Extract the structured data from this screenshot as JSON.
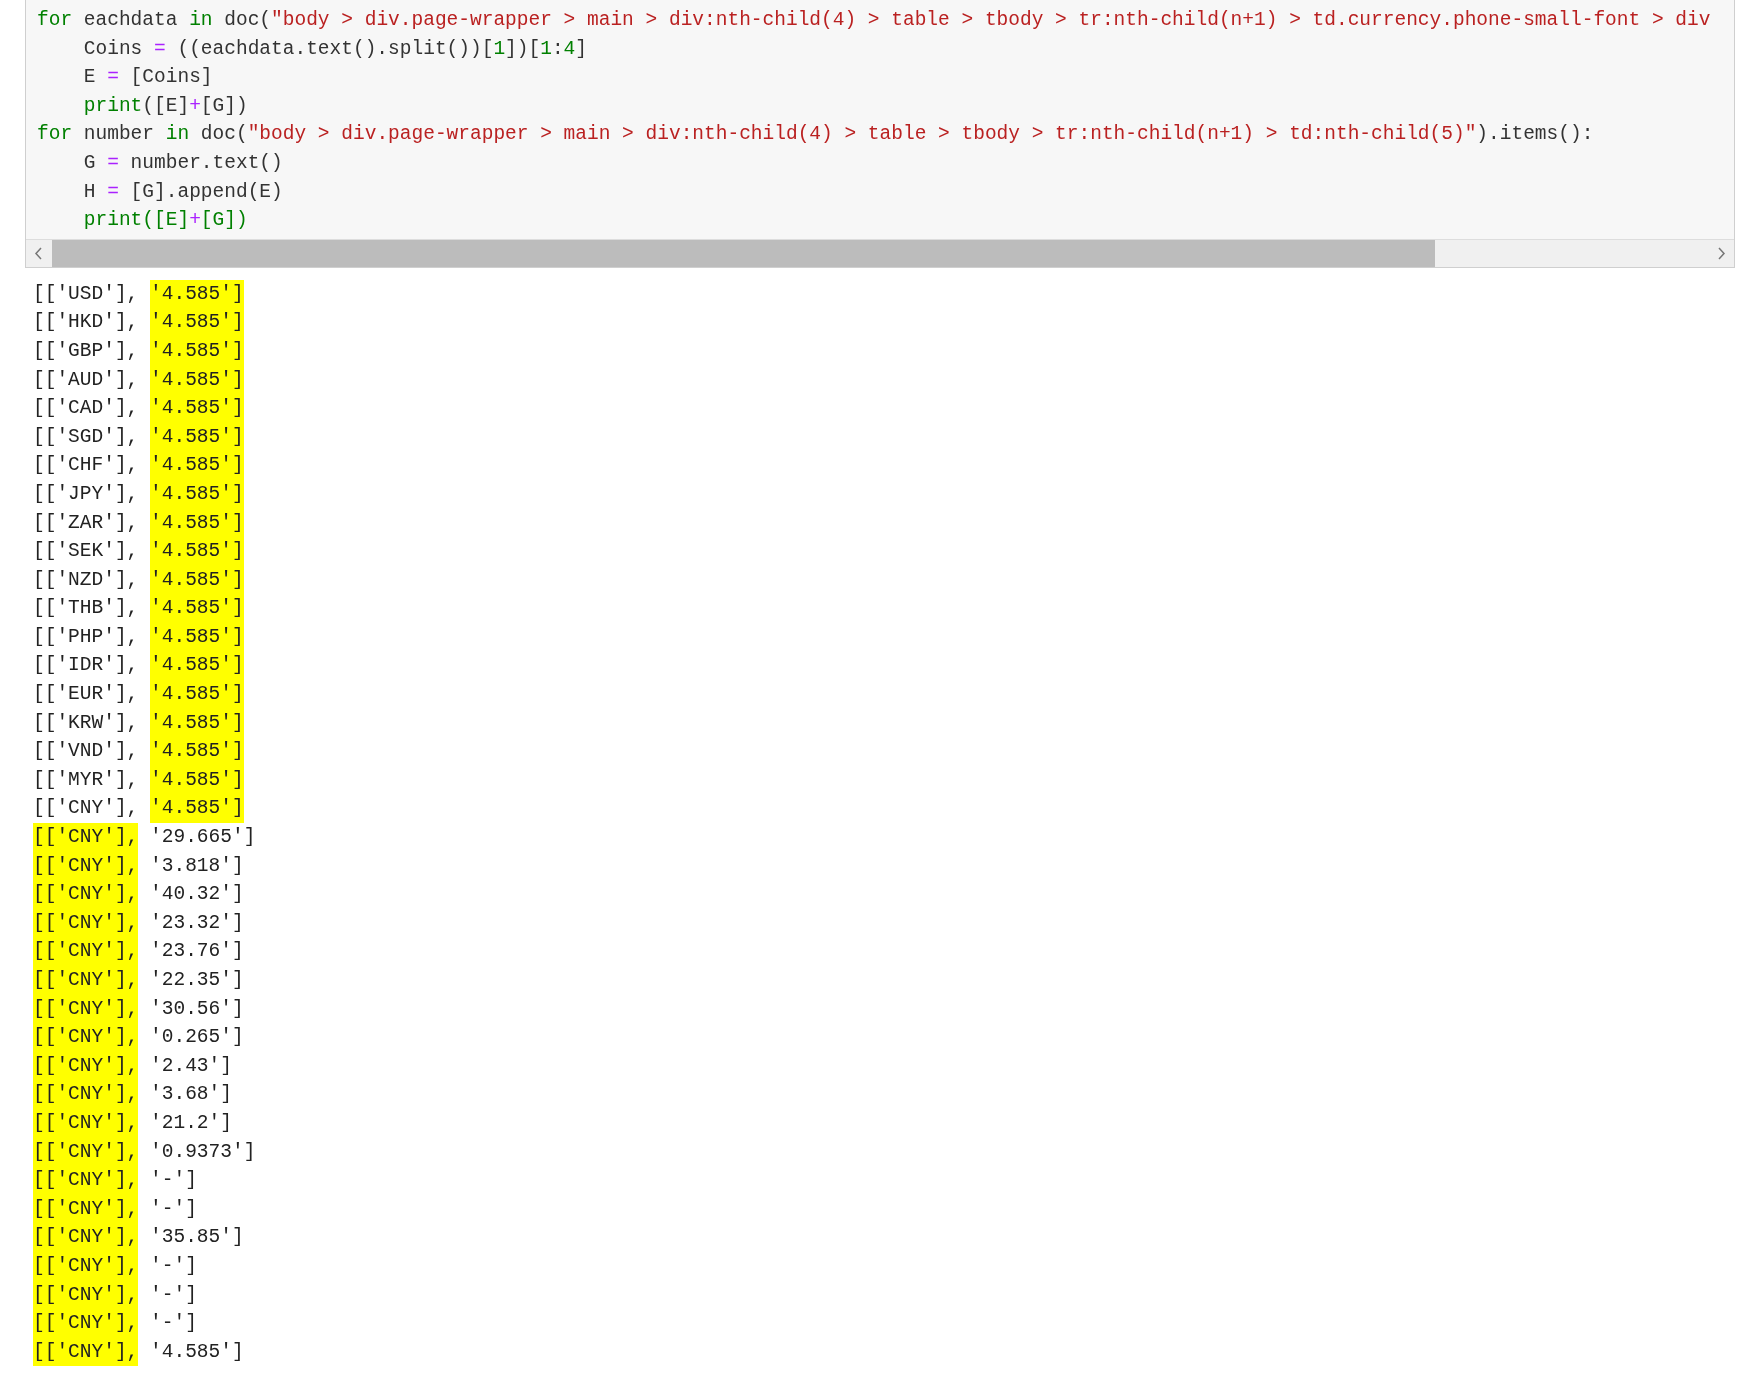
{
  "code_cell": {
    "lines": [
      [
        {
          "kind": "keyword",
          "text": "for"
        },
        {
          "kind": "plain",
          "text": " eachdata "
        },
        {
          "kind": "keyword",
          "text": "in"
        },
        {
          "kind": "plain",
          "text": " doc("
        },
        {
          "kind": "string",
          "text": "\"body > div.page-wrapper > main > div:nth-child(4) > table > tbody > tr:nth-child(n+1) > td.currency.phone-small-font > div"
        }
      ],
      [
        {
          "kind": "plain",
          "text": "    Coins "
        },
        {
          "kind": "operator",
          "text": "="
        },
        {
          "kind": "plain",
          "text": " ((eachdata.text().split())["
        },
        {
          "kind": "number",
          "text": "1"
        },
        {
          "kind": "plain",
          "text": "])["
        },
        {
          "kind": "number",
          "text": "1"
        },
        {
          "kind": "plain",
          "text": ":"
        },
        {
          "kind": "number",
          "text": "4"
        },
        {
          "kind": "plain",
          "text": "]"
        }
      ],
      [
        {
          "kind": "plain",
          "text": "    E "
        },
        {
          "kind": "operator",
          "text": "="
        },
        {
          "kind": "plain",
          "text": " [Coins]"
        }
      ],
      [
        {
          "kind": "builtin",
          "text": "    print"
        },
        {
          "kind": "plain",
          "text": "([E]"
        },
        {
          "kind": "operator",
          "text": "+"
        },
        {
          "kind": "plain",
          "text": "[G])"
        }
      ],
      [
        {
          "kind": "keyword",
          "text": "for"
        },
        {
          "kind": "plain",
          "text": " number "
        },
        {
          "kind": "keyword",
          "text": "in"
        },
        {
          "kind": "plain",
          "text": " doc("
        },
        {
          "kind": "string",
          "text": "\"body > div.page-wrapper > main > div:nth-child(4) > table > tbody > tr:nth-child(n+1) > td:nth-child(5)\""
        },
        {
          "kind": "plain",
          "text": ").items():"
        }
      ],
      [
        {
          "kind": "plain",
          "text": "    G "
        },
        {
          "kind": "operator",
          "text": "="
        },
        {
          "kind": "plain",
          "text": " number.text()"
        }
      ],
      [
        {
          "kind": "plain",
          "text": "    H "
        },
        {
          "kind": "operator",
          "text": "="
        },
        {
          "kind": "plain",
          "text": " [G].append(E)"
        }
      ],
      [
        {
          "kind": "builtin",
          "text": "    print([E]"
        },
        {
          "kind": "operator",
          "text": "+"
        },
        {
          "kind": "builtin",
          "text": "[G])"
        }
      ]
    ]
  },
  "output": [
    {
      "currency": "[['USD'],",
      "value": "'4.585']",
      "currency_highlighted": false,
      "value_highlighted": true
    },
    {
      "currency": "[['HKD'],",
      "value": "'4.585']",
      "currency_highlighted": false,
      "value_highlighted": true
    },
    {
      "currency": "[['GBP'],",
      "value": "'4.585']",
      "currency_highlighted": false,
      "value_highlighted": true
    },
    {
      "currency": "[['AUD'],",
      "value": "'4.585']",
      "currency_highlighted": false,
      "value_highlighted": true
    },
    {
      "currency": "[['CAD'],",
      "value": "'4.585']",
      "currency_highlighted": false,
      "value_highlighted": true
    },
    {
      "currency": "[['SGD'],",
      "value": "'4.585']",
      "currency_highlighted": false,
      "value_highlighted": true
    },
    {
      "currency": "[['CHF'],",
      "value": "'4.585']",
      "currency_highlighted": false,
      "value_highlighted": true
    },
    {
      "currency": "[['JPY'],",
      "value": "'4.585']",
      "currency_highlighted": false,
      "value_highlighted": true
    },
    {
      "currency": "[['ZAR'],",
      "value": "'4.585']",
      "currency_highlighted": false,
      "value_highlighted": true
    },
    {
      "currency": "[['SEK'],",
      "value": "'4.585']",
      "currency_highlighted": false,
      "value_highlighted": true
    },
    {
      "currency": "[['NZD'],",
      "value": "'4.585']",
      "currency_highlighted": false,
      "value_highlighted": true
    },
    {
      "currency": "[['THB'],",
      "value": "'4.585']",
      "currency_highlighted": false,
      "value_highlighted": true
    },
    {
      "currency": "[['PHP'],",
      "value": "'4.585']",
      "currency_highlighted": false,
      "value_highlighted": true
    },
    {
      "currency": "[['IDR'],",
      "value": "'4.585']",
      "currency_highlighted": false,
      "value_highlighted": true
    },
    {
      "currency": "[['EUR'],",
      "value": "'4.585']",
      "currency_highlighted": false,
      "value_highlighted": true
    },
    {
      "currency": "[['KRW'],",
      "value": "'4.585']",
      "currency_highlighted": false,
      "value_highlighted": true
    },
    {
      "currency": "[['VND'],",
      "value": "'4.585']",
      "currency_highlighted": false,
      "value_highlighted": true
    },
    {
      "currency": "[['MYR'],",
      "value": "'4.585']",
      "currency_highlighted": false,
      "value_highlighted": true
    },
    {
      "currency": "[['CNY'],",
      "value": "'4.585']",
      "currency_highlighted": false,
      "value_highlighted": true
    },
    {
      "currency": "[['CNY'],",
      "value": "'29.665']",
      "currency_highlighted": true,
      "value_highlighted": false
    },
    {
      "currency": "[['CNY'],",
      "value": "'3.818']",
      "currency_highlighted": true,
      "value_highlighted": false
    },
    {
      "currency": "[['CNY'],",
      "value": "'40.32']",
      "currency_highlighted": true,
      "value_highlighted": false
    },
    {
      "currency": "[['CNY'],",
      "value": "'23.32']",
      "currency_highlighted": true,
      "value_highlighted": false
    },
    {
      "currency": "[['CNY'],",
      "value": "'23.76']",
      "currency_highlighted": true,
      "value_highlighted": false
    },
    {
      "currency": "[['CNY'],",
      "value": "'22.35']",
      "currency_highlighted": true,
      "value_highlighted": false
    },
    {
      "currency": "[['CNY'],",
      "value": "'30.56']",
      "currency_highlighted": true,
      "value_highlighted": false
    },
    {
      "currency": "[['CNY'],",
      "value": "'0.265']",
      "currency_highlighted": true,
      "value_highlighted": false
    },
    {
      "currency": "[['CNY'],",
      "value": "'2.43']",
      "currency_highlighted": true,
      "value_highlighted": false
    },
    {
      "currency": "[['CNY'],",
      "value": "'3.68']",
      "currency_highlighted": true,
      "value_highlighted": false
    },
    {
      "currency": "[['CNY'],",
      "value": "'21.2']",
      "currency_highlighted": true,
      "value_highlighted": false
    },
    {
      "currency": "[['CNY'],",
      "value": "'0.9373']",
      "currency_highlighted": true,
      "value_highlighted": false
    },
    {
      "currency": "[['CNY'],",
      "value": "'-']",
      "currency_highlighted": true,
      "value_highlighted": false
    },
    {
      "currency": "[['CNY'],",
      "value": "'-']",
      "currency_highlighted": true,
      "value_highlighted": false
    },
    {
      "currency": "[['CNY'],",
      "value": "'35.85']",
      "currency_highlighted": true,
      "value_highlighted": false
    },
    {
      "currency": "[['CNY'],",
      "value": "'-']",
      "currency_highlighted": true,
      "value_highlighted": false
    },
    {
      "currency": "[['CNY'],",
      "value": "'-']",
      "currency_highlighted": true,
      "value_highlighted": false
    },
    {
      "currency": "[['CNY'],",
      "value": "'-']",
      "currency_highlighted": true,
      "value_highlighted": false
    },
    {
      "currency": "[['CNY'],",
      "value": "'4.585']",
      "currency_highlighted": true,
      "value_highlighted": false
    }
  ]
}
